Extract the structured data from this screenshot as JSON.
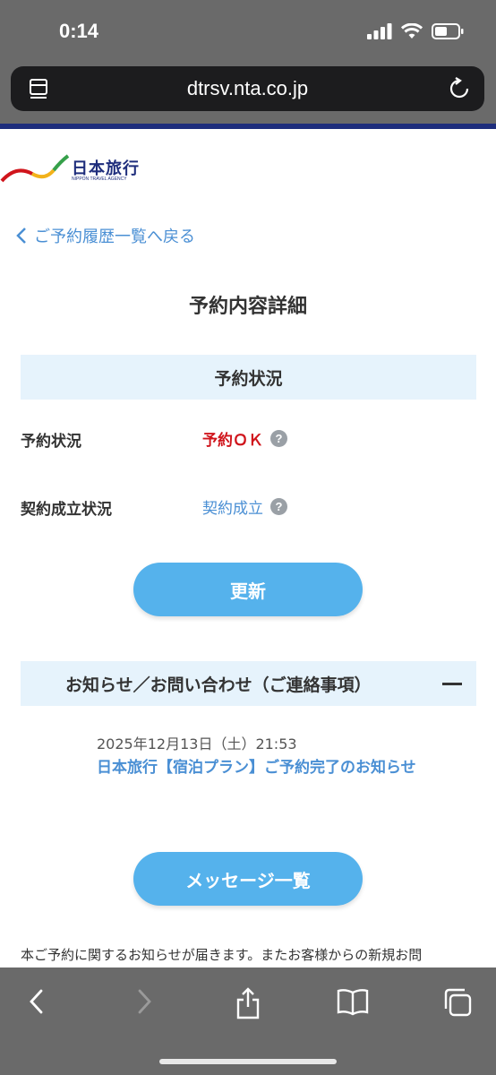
{
  "status_bar": {
    "time": "0:14"
  },
  "browser": {
    "url": "dtrsv.nta.co.jp"
  },
  "logo": {
    "name": "日本旅行",
    "sub": "NIPPON TRAVEL AGENCY"
  },
  "nav": {
    "back_label": "ご予約履歴一覧へ戻る"
  },
  "page": {
    "title": "予約内容詳細"
  },
  "reservation_status": {
    "header": "予約状況",
    "rows": [
      {
        "label": "予約状況",
        "value": "予約ＯＫ",
        "help": "?"
      },
      {
        "label": "契約成立状況",
        "value": "契約成立",
        "help": "?"
      }
    ],
    "refresh_label": "更新"
  },
  "notices": {
    "header": "お知らせ／お問い合わせ（ご連絡事項）",
    "messages": [
      {
        "date": "2025年12月13日（土）21:53",
        "title": "日本旅行【宿泊プラン】ご予約完了のお知らせ"
      }
    ],
    "message_list_label": "メッセージ一覧",
    "footer_text": "本ご予約に関するお知らせが届きます。またお客様からの新規お問"
  },
  "colors": {
    "accent": "#55b2ec",
    "link": "#4a8fd4",
    "status_ok": "#d0151c",
    "brand": "#1e2d7c"
  }
}
